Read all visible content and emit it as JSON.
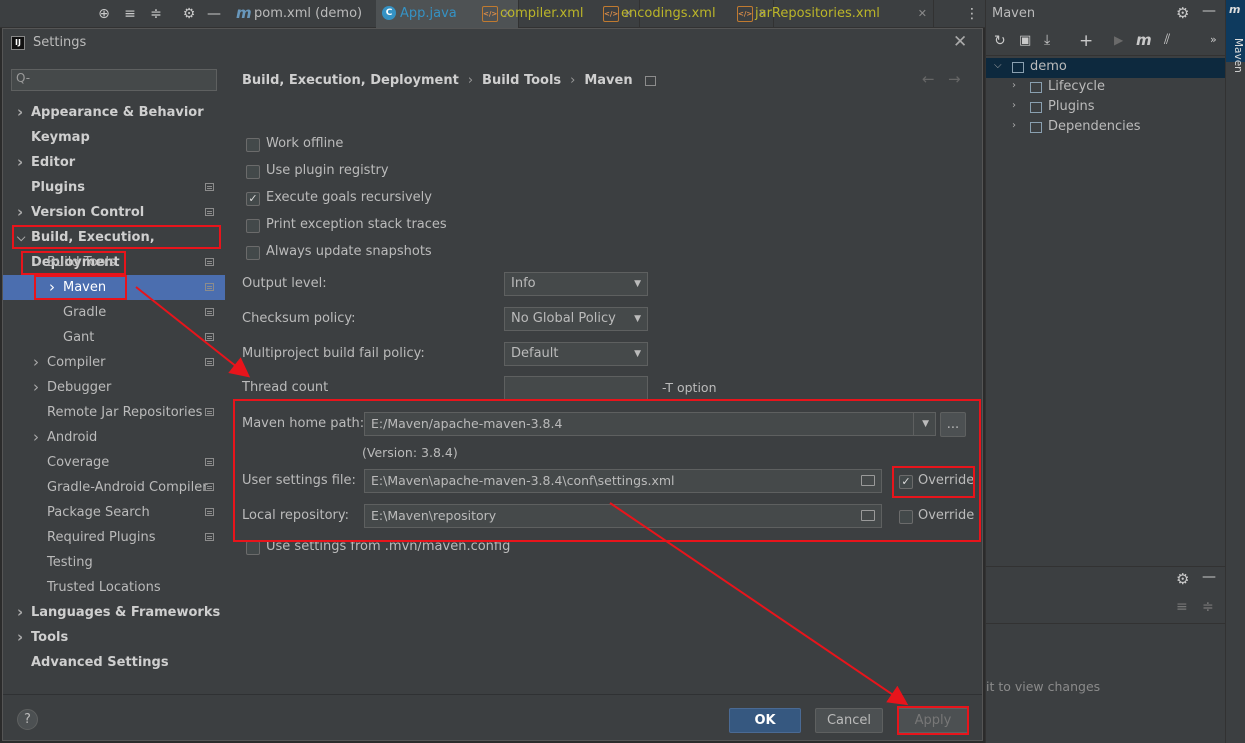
{
  "editor_tabs": [
    {
      "label": "pom.xml (demo)",
      "icon": "maven-m-icon",
      "color": "#bbbbbb",
      "active": false
    },
    {
      "label": "App.java",
      "icon": "java-class-icon",
      "color": "#3592c4",
      "active": true
    },
    {
      "label": "compiler.xml",
      "icon": "xml-file-icon",
      "color": "#bbb529",
      "active": false
    },
    {
      "label": "encodings.xml",
      "icon": "xml-file-icon",
      "color": "#bbb529",
      "active": false
    },
    {
      "label": "jarRepositories.xml",
      "icon": "xml-file-icon",
      "color": "#bbb529",
      "active": false
    }
  ],
  "maven_panel": {
    "title": "Maven",
    "stripe_label": "Maven",
    "tree": [
      {
        "label": "demo",
        "icon": "maven-project-icon"
      },
      {
        "label": "Lifecycle",
        "icon": "folder-gear-icon"
      },
      {
        "label": "Plugins",
        "icon": "folder-gear-icon"
      },
      {
        "label": "Dependencies",
        "icon": "folder-lib-icon"
      }
    ],
    "hint": "it to view changes"
  },
  "dialog": {
    "title": "Settings",
    "search_placeholder": "Q-",
    "sidebar": [
      {
        "label": "Appearance & Behavior",
        "level": 0,
        "bold": true,
        "chevron": "right",
        "cfg": false
      },
      {
        "label": "Keymap",
        "level": 0,
        "bold": true,
        "chevron": "",
        "cfg": false
      },
      {
        "label": "Editor",
        "level": 0,
        "bold": true,
        "chevron": "right",
        "cfg": false
      },
      {
        "label": "Plugins",
        "level": 0,
        "bold": true,
        "chevron": "",
        "cfg": true
      },
      {
        "label": "Version Control",
        "level": 0,
        "bold": true,
        "chevron": "right",
        "cfg": true
      },
      {
        "label": "Build, Execution, Deployment",
        "level": 0,
        "bold": true,
        "chevron": "down",
        "cfg": false
      },
      {
        "label": "Build Tools",
        "level": 1,
        "bold": false,
        "chevron": "down",
        "cfg": true
      },
      {
        "label": "Maven",
        "level": 2,
        "bold": false,
        "chevron": "right",
        "cfg": true,
        "selected": true
      },
      {
        "label": "Gradle",
        "level": 2,
        "bold": false,
        "chevron": "",
        "cfg": true
      },
      {
        "label": "Gant",
        "level": 2,
        "bold": false,
        "chevron": "",
        "cfg": true
      },
      {
        "label": "Compiler",
        "level": 1,
        "bold": false,
        "chevron": "right",
        "cfg": true
      },
      {
        "label": "Debugger",
        "level": 1,
        "bold": false,
        "chevron": "right",
        "cfg": false
      },
      {
        "label": "Remote Jar Repositories",
        "level": 1,
        "bold": false,
        "chevron": "",
        "cfg": true
      },
      {
        "label": "Android",
        "level": 1,
        "bold": false,
        "chevron": "right",
        "cfg": false
      },
      {
        "label": "Coverage",
        "level": 1,
        "bold": false,
        "chevron": "",
        "cfg": true
      },
      {
        "label": "Gradle-Android Compiler",
        "level": 1,
        "bold": false,
        "chevron": "",
        "cfg": true
      },
      {
        "label": "Package Search",
        "level": 1,
        "bold": false,
        "chevron": "",
        "cfg": true
      },
      {
        "label": "Required Plugins",
        "level": 1,
        "bold": false,
        "chevron": "",
        "cfg": true
      },
      {
        "label": "Testing",
        "level": 1,
        "bold": false,
        "chevron": "",
        "cfg": false
      },
      {
        "label": "Trusted Locations",
        "level": 1,
        "bold": false,
        "chevron": "",
        "cfg": false
      },
      {
        "label": "Languages & Frameworks",
        "level": 0,
        "bold": true,
        "chevron": "right",
        "cfg": false
      },
      {
        "label": "Tools",
        "level": 0,
        "bold": true,
        "chevron": "right",
        "cfg": false
      },
      {
        "label": "Advanced Settings",
        "level": 0,
        "bold": true,
        "chevron": "",
        "cfg": false
      }
    ],
    "breadcrumb": [
      "Build, Execution, Deployment",
      "Build Tools",
      "Maven"
    ],
    "breadcrumb_sep": "›",
    "checkboxes": [
      {
        "label": "Work offline",
        "checked": false
      },
      {
        "label": "Use plugin registry",
        "checked": false
      },
      {
        "label": "Execute goals recursively",
        "checked": true
      },
      {
        "label": "Print exception stack traces",
        "checked": false
      },
      {
        "label": "Always update snapshots",
        "checked": false
      }
    ],
    "output_level": {
      "label": "Output level:",
      "value": "Info"
    },
    "checksum_policy": {
      "label": "Checksum policy:",
      "value": "No Global Policy"
    },
    "fail_policy": {
      "label": "Multiproject build fail policy:",
      "value": "Default"
    },
    "thread_count": {
      "label": "Thread count",
      "value": "",
      "suffix": "-T option"
    },
    "maven_home": {
      "label": "Maven home path:",
      "value": "E:/Maven/apache-maven-3.8.4",
      "browse": "...",
      "version": "(Version: 3.8.4)"
    },
    "user_settings": {
      "label": "User settings file:",
      "value": "E:\\Maven\\apache-maven-3.8.4\\conf\\settings.xml",
      "override_label": "Override",
      "override_checked": true
    },
    "local_repo": {
      "label": "Local repository:",
      "value": "E:\\Maven\\repository",
      "override_label": "Override",
      "override_checked": false
    },
    "mvn_config": {
      "label": "Use settings from .mvn/maven.config",
      "checked": false
    },
    "buttons": {
      "ok": "OK",
      "cancel": "Cancel",
      "apply": "Apply",
      "help": "?"
    }
  },
  "colors": {
    "accent": "#4b6eaf",
    "ok_button": "#365880",
    "annotation_red": "#e8141b"
  }
}
